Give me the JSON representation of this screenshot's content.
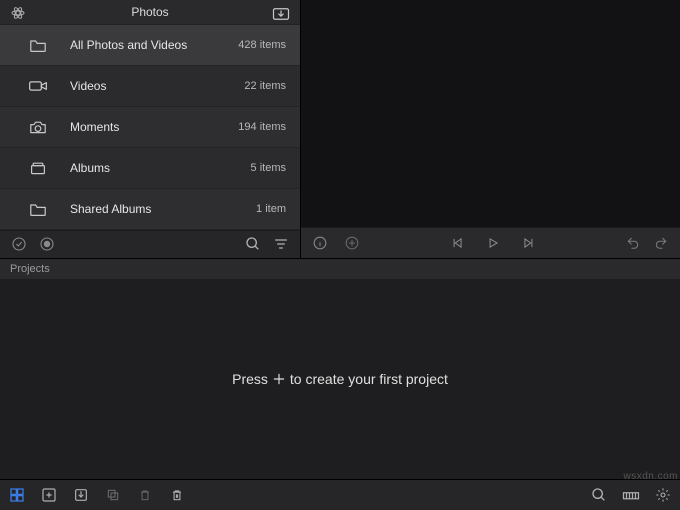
{
  "sidebar": {
    "title": "Photos",
    "items": [
      {
        "label": "All Photos and Videos",
        "count": "428 items",
        "icon": "folder-icon",
        "selected": true
      },
      {
        "label": "Videos",
        "count": "22 items",
        "icon": "video-icon",
        "selected": false
      },
      {
        "label": "Moments",
        "count": "194 items",
        "icon": "camera-icon",
        "selected": false
      },
      {
        "label": "Albums",
        "count": "5 items",
        "icon": "stack-icon",
        "selected": false
      },
      {
        "label": "Shared Albums",
        "count": "1 item",
        "icon": "folder-icon",
        "selected": false
      }
    ]
  },
  "projects": {
    "label": "Projects"
  },
  "timeline": {
    "hint_pre": "Press",
    "hint_post": "to create your first project"
  },
  "watermark": "wsxdn.com"
}
